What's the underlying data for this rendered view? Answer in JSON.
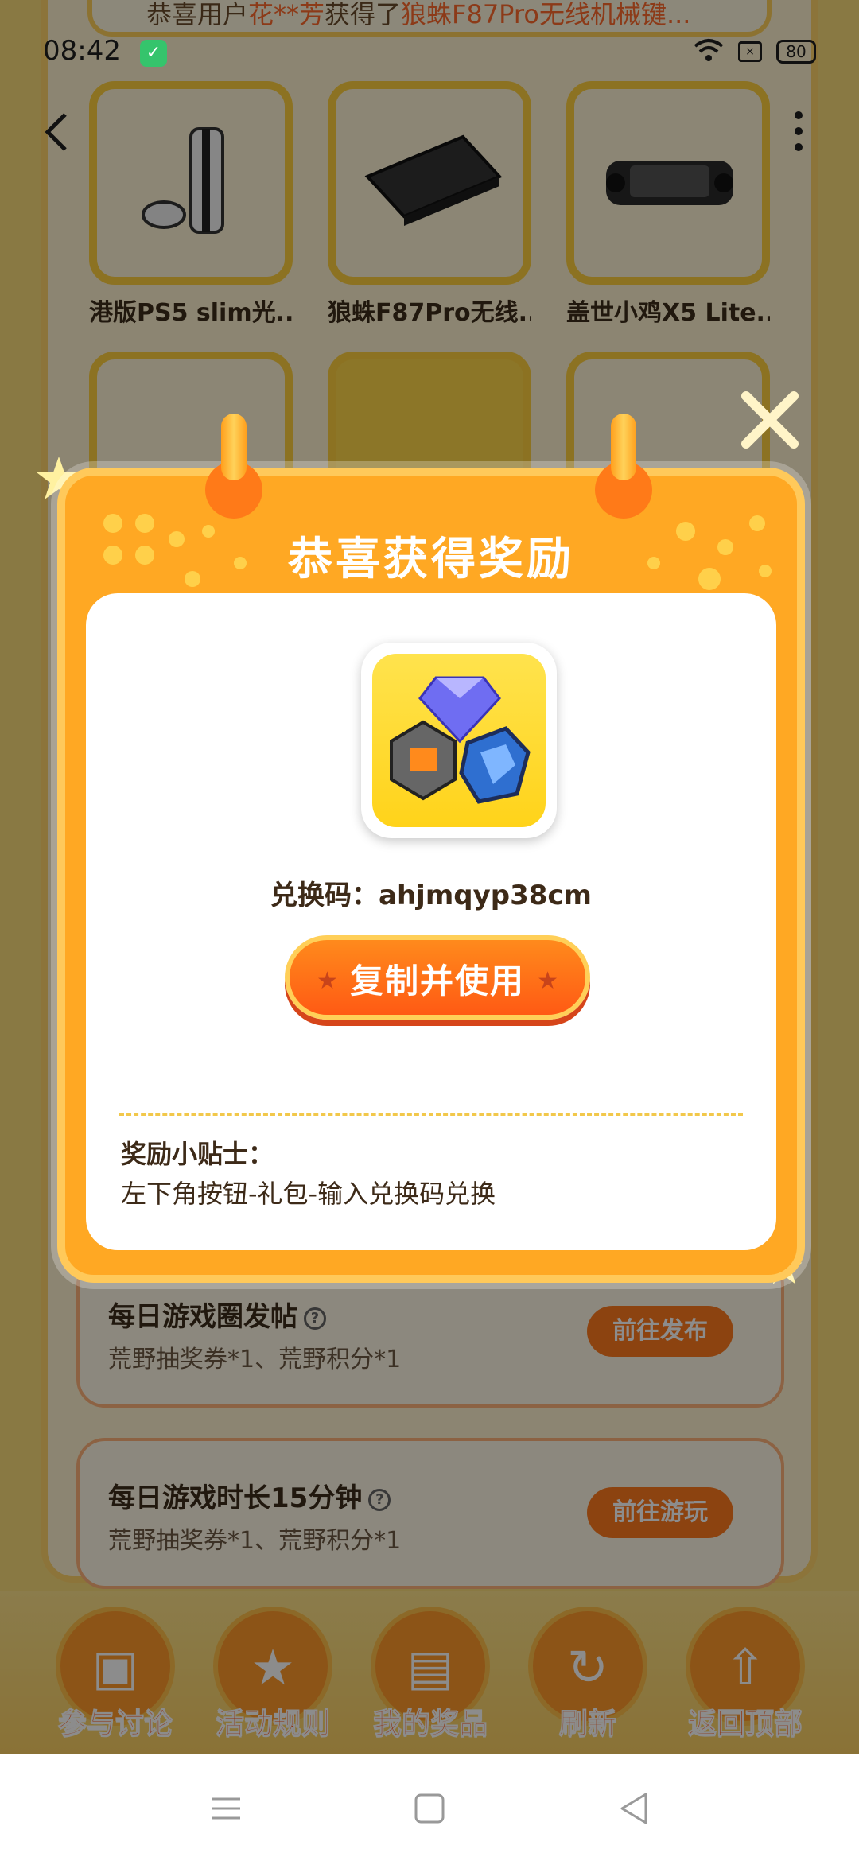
{
  "status_bar": {
    "time": "08:42",
    "battery": "80"
  },
  "ticker": {
    "prefix": "恭喜用户",
    "user": "花**芳",
    "middle": "获得了",
    "prize": "狼蛛F87Pro无线机械键..."
  },
  "prizes": [
    {
      "name": "港版PS5 slim光..."
    },
    {
      "name": "狼蛛F87Pro无线..."
    },
    {
      "name": "盖世小鸡X5 Lite..."
    }
  ],
  "tasks": [
    {
      "title_a": "每日游戏圈发帖",
      "title_b": "",
      "title_c": "",
      "reward": "荒野抽奖券*1、荒野积分*1",
      "button": "前往发布"
    },
    {
      "title_a": "每日游戏时长",
      "title_b": "15",
      "title_c": "分钟",
      "reward": "荒野抽奖券*1、荒野积分*1",
      "button": "前往游玩"
    }
  ],
  "bottom_nav": [
    {
      "label": "参与讨论",
      "icon": "chat-icon"
    },
    {
      "label": "活动规则",
      "icon": "star-icon"
    },
    {
      "label": "我的奖品",
      "icon": "gift-icon"
    },
    {
      "label": "刷新",
      "icon": "refresh-icon"
    },
    {
      "label": "返回顶部",
      "icon": "arrow-up-icon"
    }
  ],
  "modal": {
    "title": "恭喜获得奖励",
    "code_label": "兑换码：",
    "code": "ahjmqyp38cm",
    "copy_button": "复制并使用",
    "tips_title": "奖励小贴士：",
    "tips_text": "左下角按钮-礼包-输入兑换码兑换"
  },
  "colors": {
    "accent": "#ff7a1e",
    "modal_bg": "#ffa823",
    "title": "#ffffff"
  }
}
